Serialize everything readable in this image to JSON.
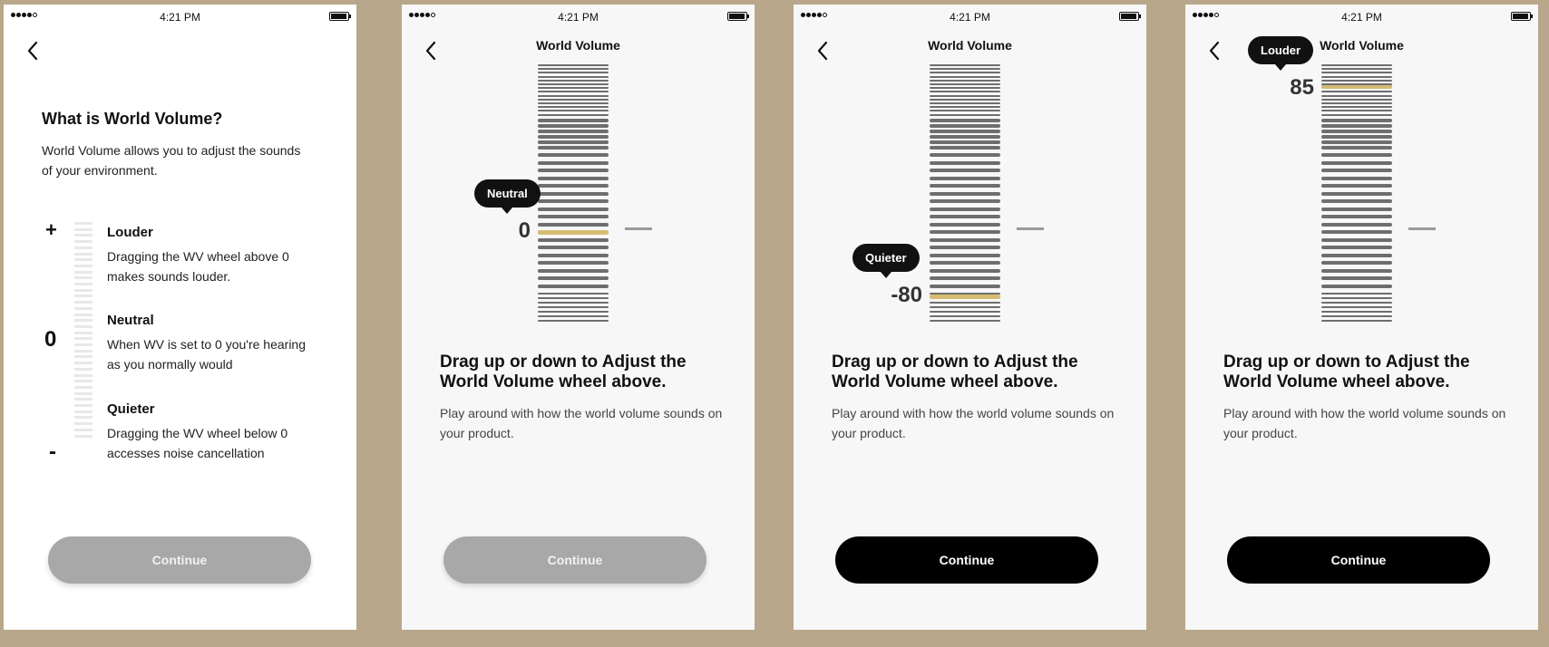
{
  "status_bar": {
    "time": "4:21 PM"
  },
  "screen1": {
    "heading": "What is World Volume?",
    "intro": "World Volume allows you to adjust the sounds of your environment.",
    "scale_symbols": {
      "plus": "+",
      "zero": "0",
      "minus": "-"
    },
    "items": [
      {
        "title": "Louder",
        "desc": "Dragging the WV wheel above 0 makes sounds louder."
      },
      {
        "title": "Neutral",
        "desc": "When WV is set to 0 you're hearing as you normally would"
      },
      {
        "title": "Quieter",
        "desc": "Dragging the WV wheel below 0 accesses noise cancellation"
      }
    ],
    "continue_label": "Continue",
    "continue_state": "disabled"
  },
  "adjust_screens": [
    {
      "nav_title": "World Volume",
      "bubble": "Neutral",
      "value": "0",
      "selected_value": 0,
      "prompt": "Drag up or down to Adjust the World Volume wheel above.",
      "subtext": "Play around with how the world volume sounds on your product.",
      "continue_label": "Continue",
      "continue_state": "disabled"
    },
    {
      "nav_title": "World Volume",
      "bubble": "Quieter",
      "value": "-80",
      "selected_value": -80,
      "prompt": "Drag up or down to Adjust the World Volume wheel above.",
      "subtext": "Play around with how the world volume sounds on your product.",
      "continue_label": "Continue",
      "continue_state": "enabled"
    },
    {
      "nav_title": "World Volume",
      "bubble": "Louder",
      "value": "85",
      "selected_value": 85,
      "prompt": "Drag up or down to Adjust the World Volume wheel above.",
      "subtext": "Play around with how the world volume sounds on your product.",
      "continue_label": "Continue",
      "continue_state": "enabled"
    }
  ],
  "colors": {
    "background": "#b8a78b",
    "accent_selected": "#d6bd73",
    "tick": "#6e6e6e",
    "button_disabled": "#a8a8a8",
    "button_enabled": "#000000"
  },
  "icons": {
    "back": "chevron-left-icon",
    "battery": "battery-icon",
    "signal": "signal-icon"
  }
}
